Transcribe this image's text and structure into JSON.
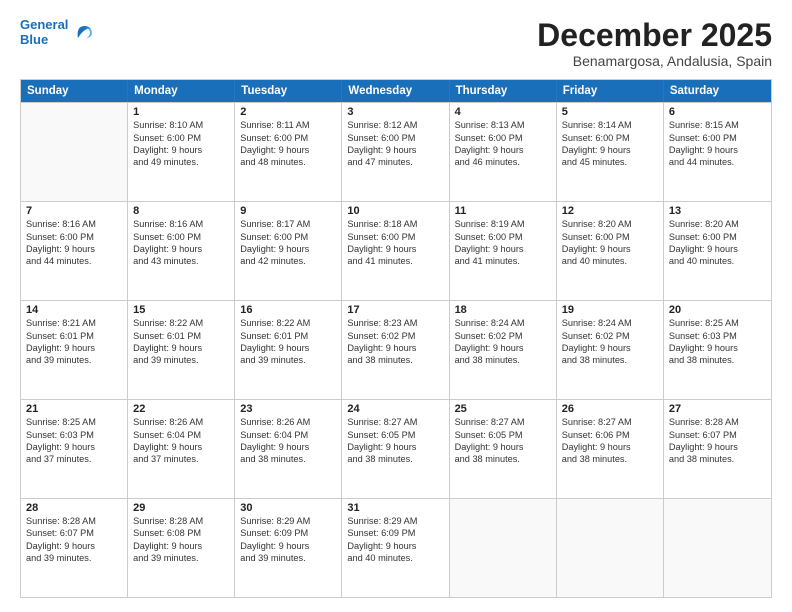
{
  "logo": {
    "line1": "General",
    "line2": "Blue",
    "icon_color": "#1a6fba"
  },
  "title": "December 2025",
  "subtitle": "Benamargosa, Andalusia, Spain",
  "days_of_week": [
    "Sunday",
    "Monday",
    "Tuesday",
    "Wednesday",
    "Thursday",
    "Friday",
    "Saturday"
  ],
  "weeks": [
    [
      {
        "day": "",
        "empty": true
      },
      {
        "day": "1",
        "rise": "8:10 AM",
        "set": "6:00 PM",
        "daylight": "9 hours and 49 minutes."
      },
      {
        "day": "2",
        "rise": "8:11 AM",
        "set": "6:00 PM",
        "daylight": "9 hours and 48 minutes."
      },
      {
        "day": "3",
        "rise": "8:12 AM",
        "set": "6:00 PM",
        "daylight": "9 hours and 47 minutes."
      },
      {
        "day": "4",
        "rise": "8:13 AM",
        "set": "6:00 PM",
        "daylight": "9 hours and 46 minutes."
      },
      {
        "day": "5",
        "rise": "8:14 AM",
        "set": "6:00 PM",
        "daylight": "9 hours and 45 minutes."
      },
      {
        "day": "6",
        "rise": "8:15 AM",
        "set": "6:00 PM",
        "daylight": "9 hours and 44 minutes."
      }
    ],
    [
      {
        "day": "7",
        "rise": "8:16 AM",
        "set": "6:00 PM",
        "daylight": "9 hours and 44 minutes."
      },
      {
        "day": "8",
        "rise": "8:16 AM",
        "set": "6:00 PM",
        "daylight": "9 hours and 43 minutes."
      },
      {
        "day": "9",
        "rise": "8:17 AM",
        "set": "6:00 PM",
        "daylight": "9 hours and 42 minutes."
      },
      {
        "day": "10",
        "rise": "8:18 AM",
        "set": "6:00 PM",
        "daylight": "9 hours and 41 minutes."
      },
      {
        "day": "11",
        "rise": "8:19 AM",
        "set": "6:00 PM",
        "daylight": "9 hours and 41 minutes."
      },
      {
        "day": "12",
        "rise": "8:20 AM",
        "set": "6:00 PM",
        "daylight": "9 hours and 40 minutes."
      },
      {
        "day": "13",
        "rise": "8:20 AM",
        "set": "6:00 PM",
        "daylight": "9 hours and 40 minutes."
      }
    ],
    [
      {
        "day": "14",
        "rise": "8:21 AM",
        "set": "6:01 PM",
        "daylight": "9 hours and 39 minutes."
      },
      {
        "day": "15",
        "rise": "8:22 AM",
        "set": "6:01 PM",
        "daylight": "9 hours and 39 minutes."
      },
      {
        "day": "16",
        "rise": "8:22 AM",
        "set": "6:01 PM",
        "daylight": "9 hours and 39 minutes."
      },
      {
        "day": "17",
        "rise": "8:23 AM",
        "set": "6:02 PM",
        "daylight": "9 hours and 38 minutes."
      },
      {
        "day": "18",
        "rise": "8:24 AM",
        "set": "6:02 PM",
        "daylight": "9 hours and 38 minutes."
      },
      {
        "day": "19",
        "rise": "8:24 AM",
        "set": "6:02 PM",
        "daylight": "9 hours and 38 minutes."
      },
      {
        "day": "20",
        "rise": "8:25 AM",
        "set": "6:03 PM",
        "daylight": "9 hours and 38 minutes."
      }
    ],
    [
      {
        "day": "21",
        "rise": "8:25 AM",
        "set": "6:03 PM",
        "daylight": "9 hours and 37 minutes."
      },
      {
        "day": "22",
        "rise": "8:26 AM",
        "set": "6:04 PM",
        "daylight": "9 hours and 37 minutes."
      },
      {
        "day": "23",
        "rise": "8:26 AM",
        "set": "6:04 PM",
        "daylight": "9 hours and 38 minutes."
      },
      {
        "day": "24",
        "rise": "8:27 AM",
        "set": "6:05 PM",
        "daylight": "9 hours and 38 minutes."
      },
      {
        "day": "25",
        "rise": "8:27 AM",
        "set": "6:05 PM",
        "daylight": "9 hours and 38 minutes."
      },
      {
        "day": "26",
        "rise": "8:27 AM",
        "set": "6:06 PM",
        "daylight": "9 hours and 38 minutes."
      },
      {
        "day": "27",
        "rise": "8:28 AM",
        "set": "6:07 PM",
        "daylight": "9 hours and 38 minutes."
      }
    ],
    [
      {
        "day": "28",
        "rise": "8:28 AM",
        "set": "6:07 PM",
        "daylight": "9 hours and 39 minutes."
      },
      {
        "day": "29",
        "rise": "8:28 AM",
        "set": "6:08 PM",
        "daylight": "9 hours and 39 minutes."
      },
      {
        "day": "30",
        "rise": "8:29 AM",
        "set": "6:09 PM",
        "daylight": "9 hours and 39 minutes."
      },
      {
        "day": "31",
        "rise": "8:29 AM",
        "set": "6:09 PM",
        "daylight": "9 hours and 40 minutes."
      },
      {
        "day": "",
        "empty": true
      },
      {
        "day": "",
        "empty": true
      },
      {
        "day": "",
        "empty": true
      }
    ]
  ]
}
